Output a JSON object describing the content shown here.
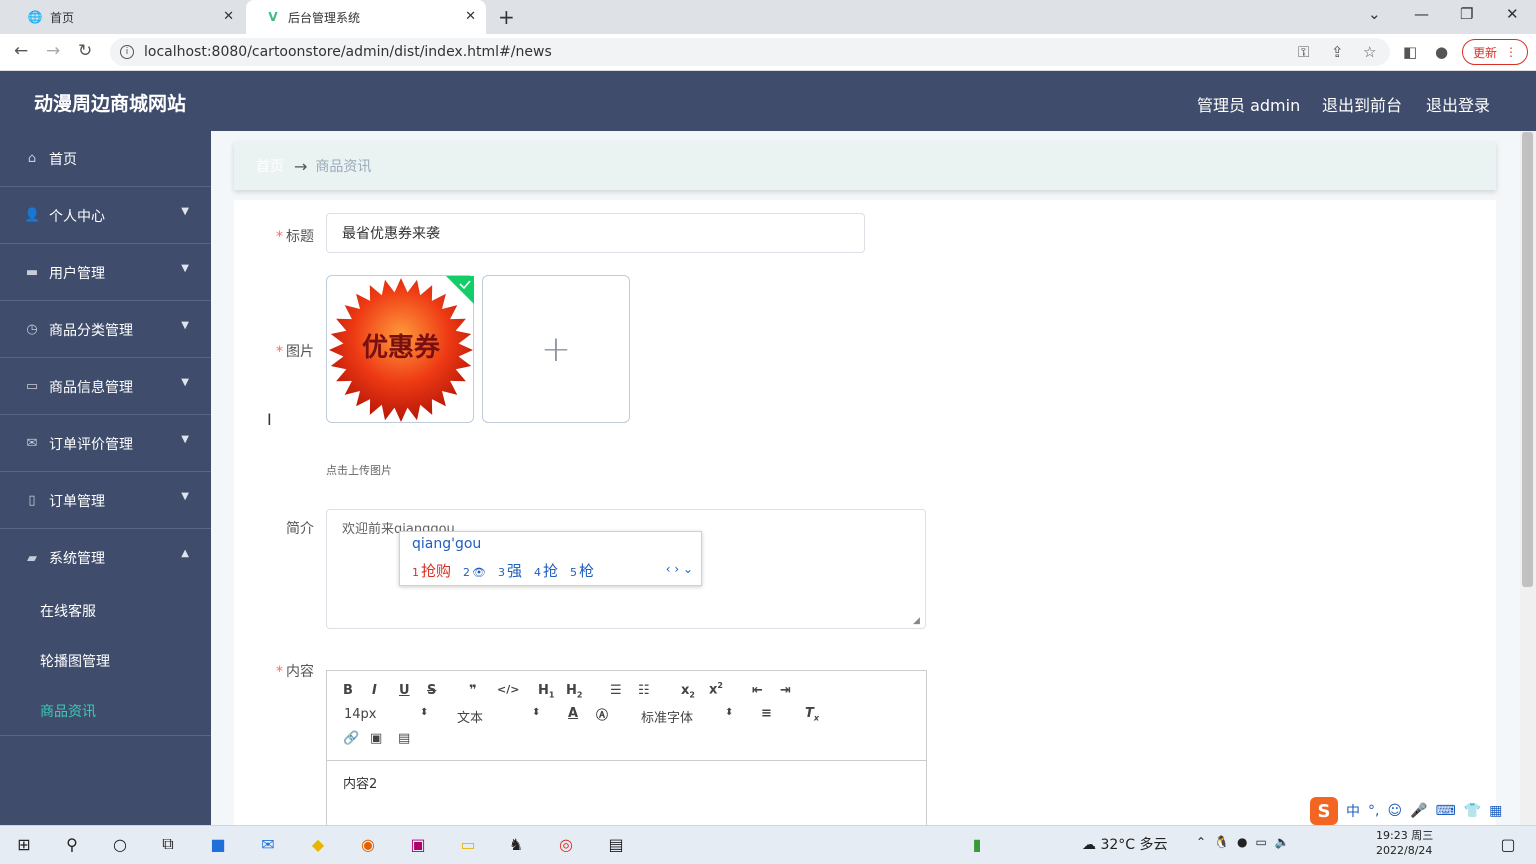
{
  "browser": {
    "tabs": [
      {
        "title": "首页",
        "active": false
      },
      {
        "title": "后台管理系统",
        "active": true
      }
    ],
    "url": "localhost:8080/cartoonstore/admin/dist/index.html#/news",
    "update_label": "更新"
  },
  "header": {
    "site_title": "动漫周边商城网站",
    "admin_label": "管理员 admin",
    "exit_front": "退出到前台",
    "logout": "退出登录"
  },
  "sidebar": {
    "items": [
      {
        "label": "首页",
        "icon": "home-icon",
        "expandable": false
      },
      {
        "label": "个人中心",
        "icon": "user-icon",
        "expandable": true
      },
      {
        "label": "用户管理",
        "icon": "briefcase-icon",
        "expandable": true
      },
      {
        "label": "商品分类管理",
        "icon": "clock-icon",
        "expandable": true
      },
      {
        "label": "商品信息管理",
        "icon": "monitor-icon",
        "expandable": true
      },
      {
        "label": "订单评价管理",
        "icon": "mail-icon",
        "expandable": true
      },
      {
        "label": "订单管理",
        "icon": "mic-icon",
        "expandable": true
      },
      {
        "label": "系统管理",
        "icon": "ticket-icon",
        "expandable": true,
        "expanded": true
      }
    ],
    "sub_items": [
      {
        "label": "在线客服",
        "active": false
      },
      {
        "label": "轮播图管理",
        "active": false
      },
      {
        "label": "商品资讯",
        "active": true
      }
    ]
  },
  "breadcrumb": {
    "home": "首页",
    "arrow": "→",
    "current": "商品资讯"
  },
  "form": {
    "title_label": "标题",
    "title_value": "最省优惠券来袭",
    "image_label": "图片",
    "image_text": "优惠券",
    "upload_tip": "点击上传图片",
    "intro_label": "简介",
    "intro_value": "欢迎前来qianggou",
    "content_label": "内容",
    "content_value": "内容2"
  },
  "ime": {
    "pinyin": "qiang'gou",
    "candidates": [
      {
        "n": "1",
        "text": "抢购"
      },
      {
        "n": "2",
        "text": "👁"
      },
      {
        "n": "3",
        "text": "强"
      },
      {
        "n": "4",
        "text": "抢"
      },
      {
        "n": "5",
        "text": "枪"
      }
    ]
  },
  "editor": {
    "font_size": "14px",
    "block_type": "文本",
    "font_family": "标准字体"
  },
  "taskbar": {
    "weather": "32°C 多云",
    "time": "19:23 周三",
    "date": "2022/8/24",
    "ime_mode": "中"
  }
}
